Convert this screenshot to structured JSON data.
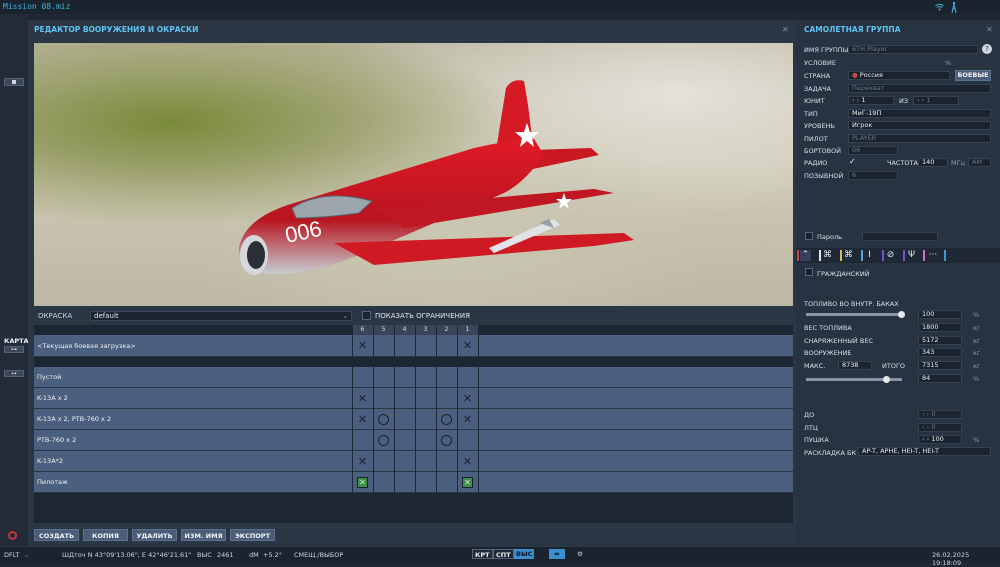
{
  "window": {
    "mission": "Mission 08.miz"
  },
  "editor": {
    "title": "РЕДАКТОР ВООРУЖЕНИЯ И ОКРАСКИ",
    "aircraft_number": "006",
    "skin_label": "ОКРАСКА",
    "skin_value": "default",
    "show_limits_label": "ПОКАЗАТЬ ОГРАНИЧЕНИЯ",
    "stations": [
      "6",
      "5",
      "4",
      "3",
      "2",
      "1"
    ],
    "current_loadout": "<Текущая боевая загрузка>",
    "loadouts": [
      {
        "name": "Пустой",
        "stores": [
          "",
          "",
          "",
          "",
          "",
          ""
        ]
      },
      {
        "name": "K-13A x 2",
        "stores": [
          "x",
          "",
          "",
          "",
          "",
          "x"
        ]
      },
      {
        "name": "K-13A x 2, РТВ-760 x 2",
        "stores": [
          "x",
          "o",
          "",
          "",
          "o",
          "x"
        ]
      },
      {
        "name": "РТВ-760 x 2",
        "stores": [
          "",
          "o",
          "",
          "",
          "o",
          ""
        ]
      },
      {
        "name": "K-13A*2",
        "stores": [
          "x",
          "",
          "",
          "",
          "",
          "x"
        ]
      },
      {
        "name": "Пилотаж",
        "stores": [
          "g",
          "",
          "",
          "",
          "",
          "g"
        ]
      }
    ],
    "buttons": {
      "create": "СОЗДАТЬ",
      "copy": "КОПИЯ",
      "delete": "УДАЛИТЬ",
      "rename": "ИЗМ. ИМЯ",
      "export": "ЭКСПОРТ"
    }
  },
  "left": {
    "map_label": "КАРТА"
  },
  "group": {
    "title": "САМОЛЕТНАЯ ГРУППА",
    "name_label": "ИМЯ ГРУППЫ",
    "name_value": "6TH Player",
    "condition_label": "УСЛОВИЕ",
    "condition_unit": "%",
    "country_label": "СТРАНА",
    "country_value": "Россия",
    "combat_btn": "БОЕВЫЕ",
    "task_label": "ЗАДАЧА",
    "task_value": "Перехват",
    "unit_label": "ЮНИТ",
    "unit_value": "1",
    "unit_of": "ИЗ",
    "unit_total": "1",
    "type_label": "ТИП",
    "type_value": "МиГ-19П",
    "level_label": "УРОВЕНЬ",
    "level_value": "Игрок",
    "pilot_label": "ПИЛОТ",
    "pilot_value": "PLAYER",
    "tail_label": "БОРТОВОЙ",
    "tail_value": "06",
    "radio_label": "РАДИО",
    "freq_label": "ЧАСТОТА",
    "freq_value": "140",
    "freq_unit": "МГц",
    "modulation": "AM",
    "callsign_label": "ПОЗЫВНОЙ",
    "callsign_value": "6",
    "password_label": "Пароль",
    "civil_label": "ГРАЖДАНСКИЙ",
    "fuel_label": "ТОПЛИВО ВО ВНУТР. БАКАХ",
    "fuel_pct": "100",
    "fuel_pct_value": 100,
    "pct": "%",
    "fuel_weight_label": "ВЕС ТОПЛИВА",
    "fuel_weight": "1800",
    "kg": "кг",
    "empty_weight_label": "СНАРЯЖЕННЫЙ ВЕС",
    "empty_weight": "5172",
    "weapons_label": "ВООРУЖЕНИЕ",
    "weapons_weight": "343",
    "max_label": "МАКС.",
    "max_value": "8738",
    "total_label": "ИТОГО",
    "total_value": "7315",
    "total_pct": "84",
    "total_pct_value": 84,
    "chaff_label": "ДО",
    "chaff_value": "0",
    "flares_label": "ЛТЦ",
    "flares_value": "0",
    "gun_label": "ПУШКА",
    "gun_value": "100",
    "belt_label": "РАСКЛАДКА БК",
    "belt_value": "AP-T, APHE, HEI-T, HEI-T",
    "tab_colors": [
      "#d0474a",
      "#e3e3e3",
      "#d6c04b",
      "#5aa0d8",
      "#7b4fd0",
      "#7b4fd0",
      "#d36ad1",
      "#3b9ad0"
    ]
  },
  "status": {
    "mode": "DFLT",
    "coords": "ШДточ  N 43°09'13.06\", E 42°46'21.61\"",
    "alt_label": "ВЫС",
    "alt_value": "2461",
    "dm_label": "dM",
    "dm_value": "+5.2°",
    "move_label": "СМЕЩ./ВЫБОР",
    "krt": "КРТ",
    "spt": "СПТ",
    "vys": "ВЫС",
    "datetime": "26.02.2025 19:18:09"
  }
}
